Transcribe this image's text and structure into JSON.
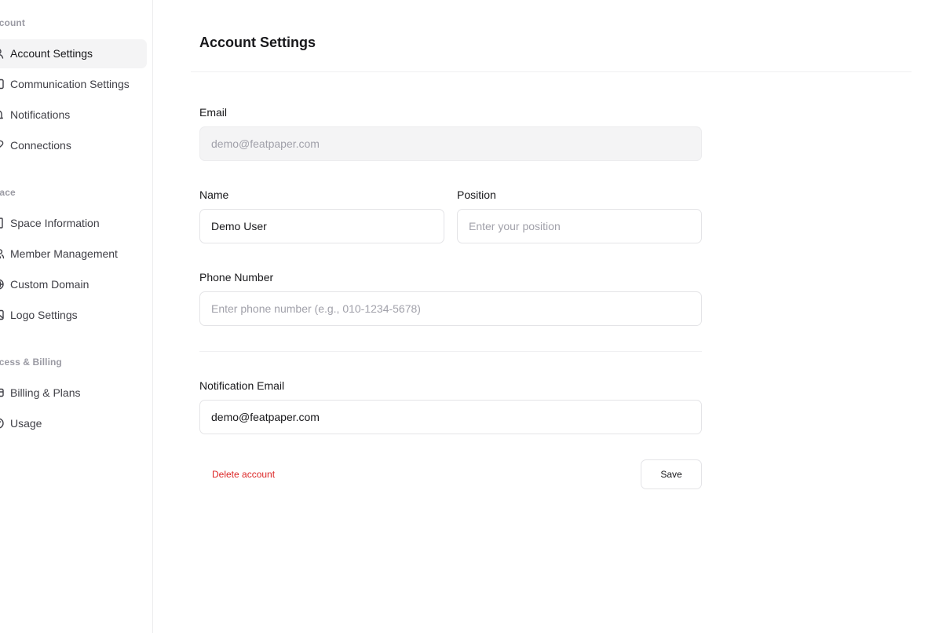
{
  "sidebar": {
    "sections": [
      {
        "title": "ccount",
        "items": [
          {
            "label": "Account Settings",
            "icon": "user-icon",
            "active": true
          },
          {
            "label": "Communication Settings",
            "icon": "message-icon",
            "active": false
          },
          {
            "label": "Notifications",
            "icon": "bell-icon",
            "active": false
          },
          {
            "label": "Connections",
            "icon": "link-icon",
            "active": false
          }
        ]
      },
      {
        "title": "pace",
        "items": [
          {
            "label": "Space Information",
            "icon": "building-icon",
            "active": false
          },
          {
            "label": "Member Management",
            "icon": "users-icon",
            "active": false
          },
          {
            "label": "Custom Domain",
            "icon": "globe-icon",
            "active": false
          },
          {
            "label": "Logo Settings",
            "icon": "image-icon",
            "active": false
          }
        ]
      },
      {
        "title": "ccess & Billing",
        "items": [
          {
            "label": "Billing & Plans",
            "icon": "credit-card-icon",
            "active": false
          },
          {
            "label": "Usage",
            "icon": "gauge-icon",
            "active": false
          }
        ]
      }
    ]
  },
  "main": {
    "title": "Account Settings",
    "form": {
      "email": {
        "label": "Email",
        "value": "",
        "placeholder": "demo@featpaper.com"
      },
      "name": {
        "label": "Name",
        "value": "Demo User",
        "placeholder": ""
      },
      "position": {
        "label": "Position",
        "value": "",
        "placeholder": "Enter your position"
      },
      "phone": {
        "label": "Phone Number",
        "value": "",
        "placeholder": "Enter phone number (e.g., 010-1234-5678)"
      },
      "notification_email": {
        "label": "Notification Email",
        "value": "demo@featpaper.com",
        "placeholder": ""
      }
    },
    "actions": {
      "delete_label": "Delete account",
      "save_label": "Save"
    }
  },
  "colors": {
    "danger": "#dc2626",
    "active_bg": "#f4f4f5",
    "border": "#e4e4e7"
  }
}
